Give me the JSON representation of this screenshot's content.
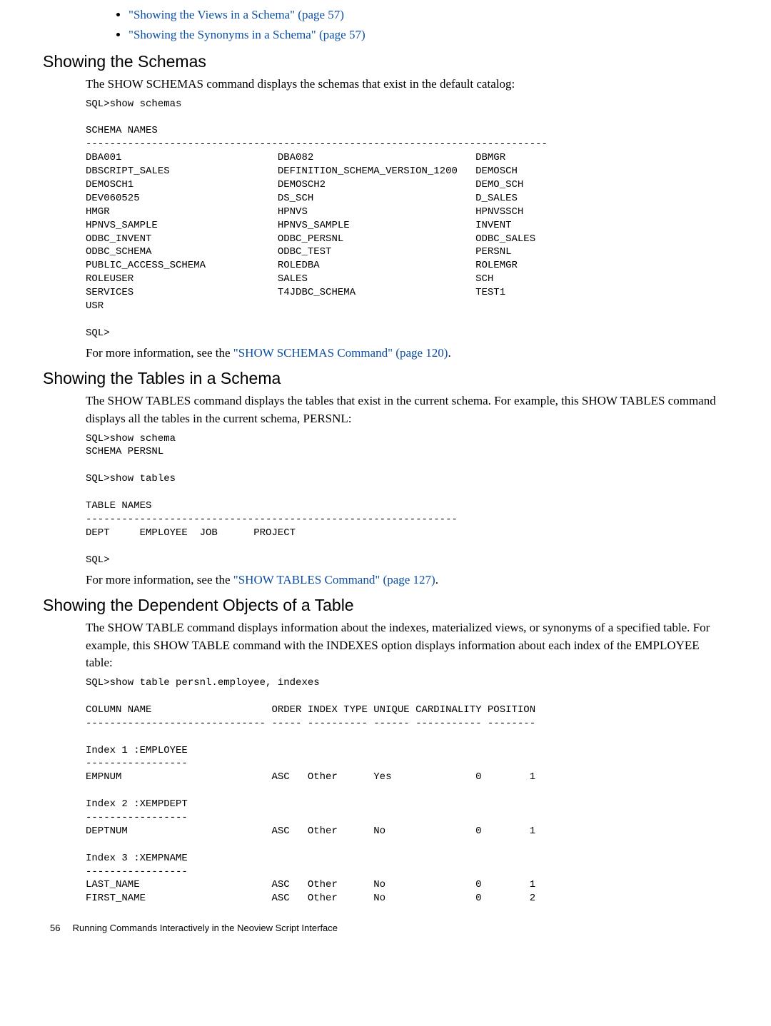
{
  "bullets": [
    "\"Showing the Views in a Schema\" (page 57)",
    "\"Showing the Synonyms in a Schema\" (page 57)"
  ],
  "section1": {
    "heading": "Showing the Schemas",
    "para": "The SHOW SCHEMAS command displays the schemas that exist in the default catalog:",
    "code": "SQL>show schemas\n\nSCHEMA NAMES\n-----------------------------------------------------------------------------\nDBA001                          DBA082                           DBMGR\nDBSCRIPT_SALES                  DEFINITION_SCHEMA_VERSION_1200   DEMOSCH\nDEMOSCH1                        DEMOSCH2                         DEMO_SCH\nDEV060525                       DS_SCH                           D_SALES\nHMGR                            HPNVS                            HPNVSSCH\nHPNVS_SAMPLE                    HPNVS_SAMPLE                     INVENT\nODBC_INVENT                     ODBC_PERSNL                      ODBC_SALES\nODBC_SCHEMA                     ODBC_TEST                        PERSNL\nPUBLIC_ACCESS_SCHEMA            ROLEDBA                          ROLEMGR\nROLEUSER                        SALES                            SCH\nSERVICES                        T4JDBC_SCHEMA                    TEST1\nUSR\n\nSQL>",
    "moreinfo_prefix": "For more information, see the ",
    "moreinfo_link": "\"SHOW SCHEMAS Command\" (page 120)",
    "moreinfo_suffix": "."
  },
  "section2": {
    "heading": "Showing the Tables in a Schema",
    "para": "The SHOW TABLES command displays the tables that exist in the current schema. For example, this SHOW TABLES command displays all the tables in the current schema, PERSNL:",
    "code": "SQL>show schema\nSCHEMA PERSNL\n\nSQL>show tables\n\nTABLE NAMES\n--------------------------------------------------------------\nDEPT     EMPLOYEE  JOB      PROJECT\n\nSQL>",
    "moreinfo_prefix": "For more information, see the ",
    "moreinfo_link": "\"SHOW TABLES Command\" (page 127)",
    "moreinfo_suffix": "."
  },
  "section3": {
    "heading": "Showing the Dependent Objects of a Table",
    "para": "The SHOW TABLE command displays information about the indexes, materialized views, or synonyms of a specified table. For example, this SHOW TABLE command with the INDEXES option displays information about each index of the EMPLOYEE table:",
    "code": "SQL>show table persnl.employee, indexes\n\nCOLUMN NAME                    ORDER INDEX TYPE UNIQUE CARDINALITY POSITION\n------------------------------ ----- ---------- ------ ----------- --------\n\nIndex 1 :EMPLOYEE\n-----------------\nEMPNUM                         ASC   Other      Yes              0        1\n\nIndex 2 :XEMPDEPT\n-----------------\nDEPTNUM                        ASC   Other      No               0        1\n\nIndex 3 :XEMPNAME\n-----------------\nLAST_NAME                      ASC   Other      No               0        1\nFIRST_NAME                     ASC   Other      No               0        2"
  },
  "footer": {
    "pagenum": "56",
    "title": "Running Commands Interactively in the Neoview Script Interface"
  }
}
